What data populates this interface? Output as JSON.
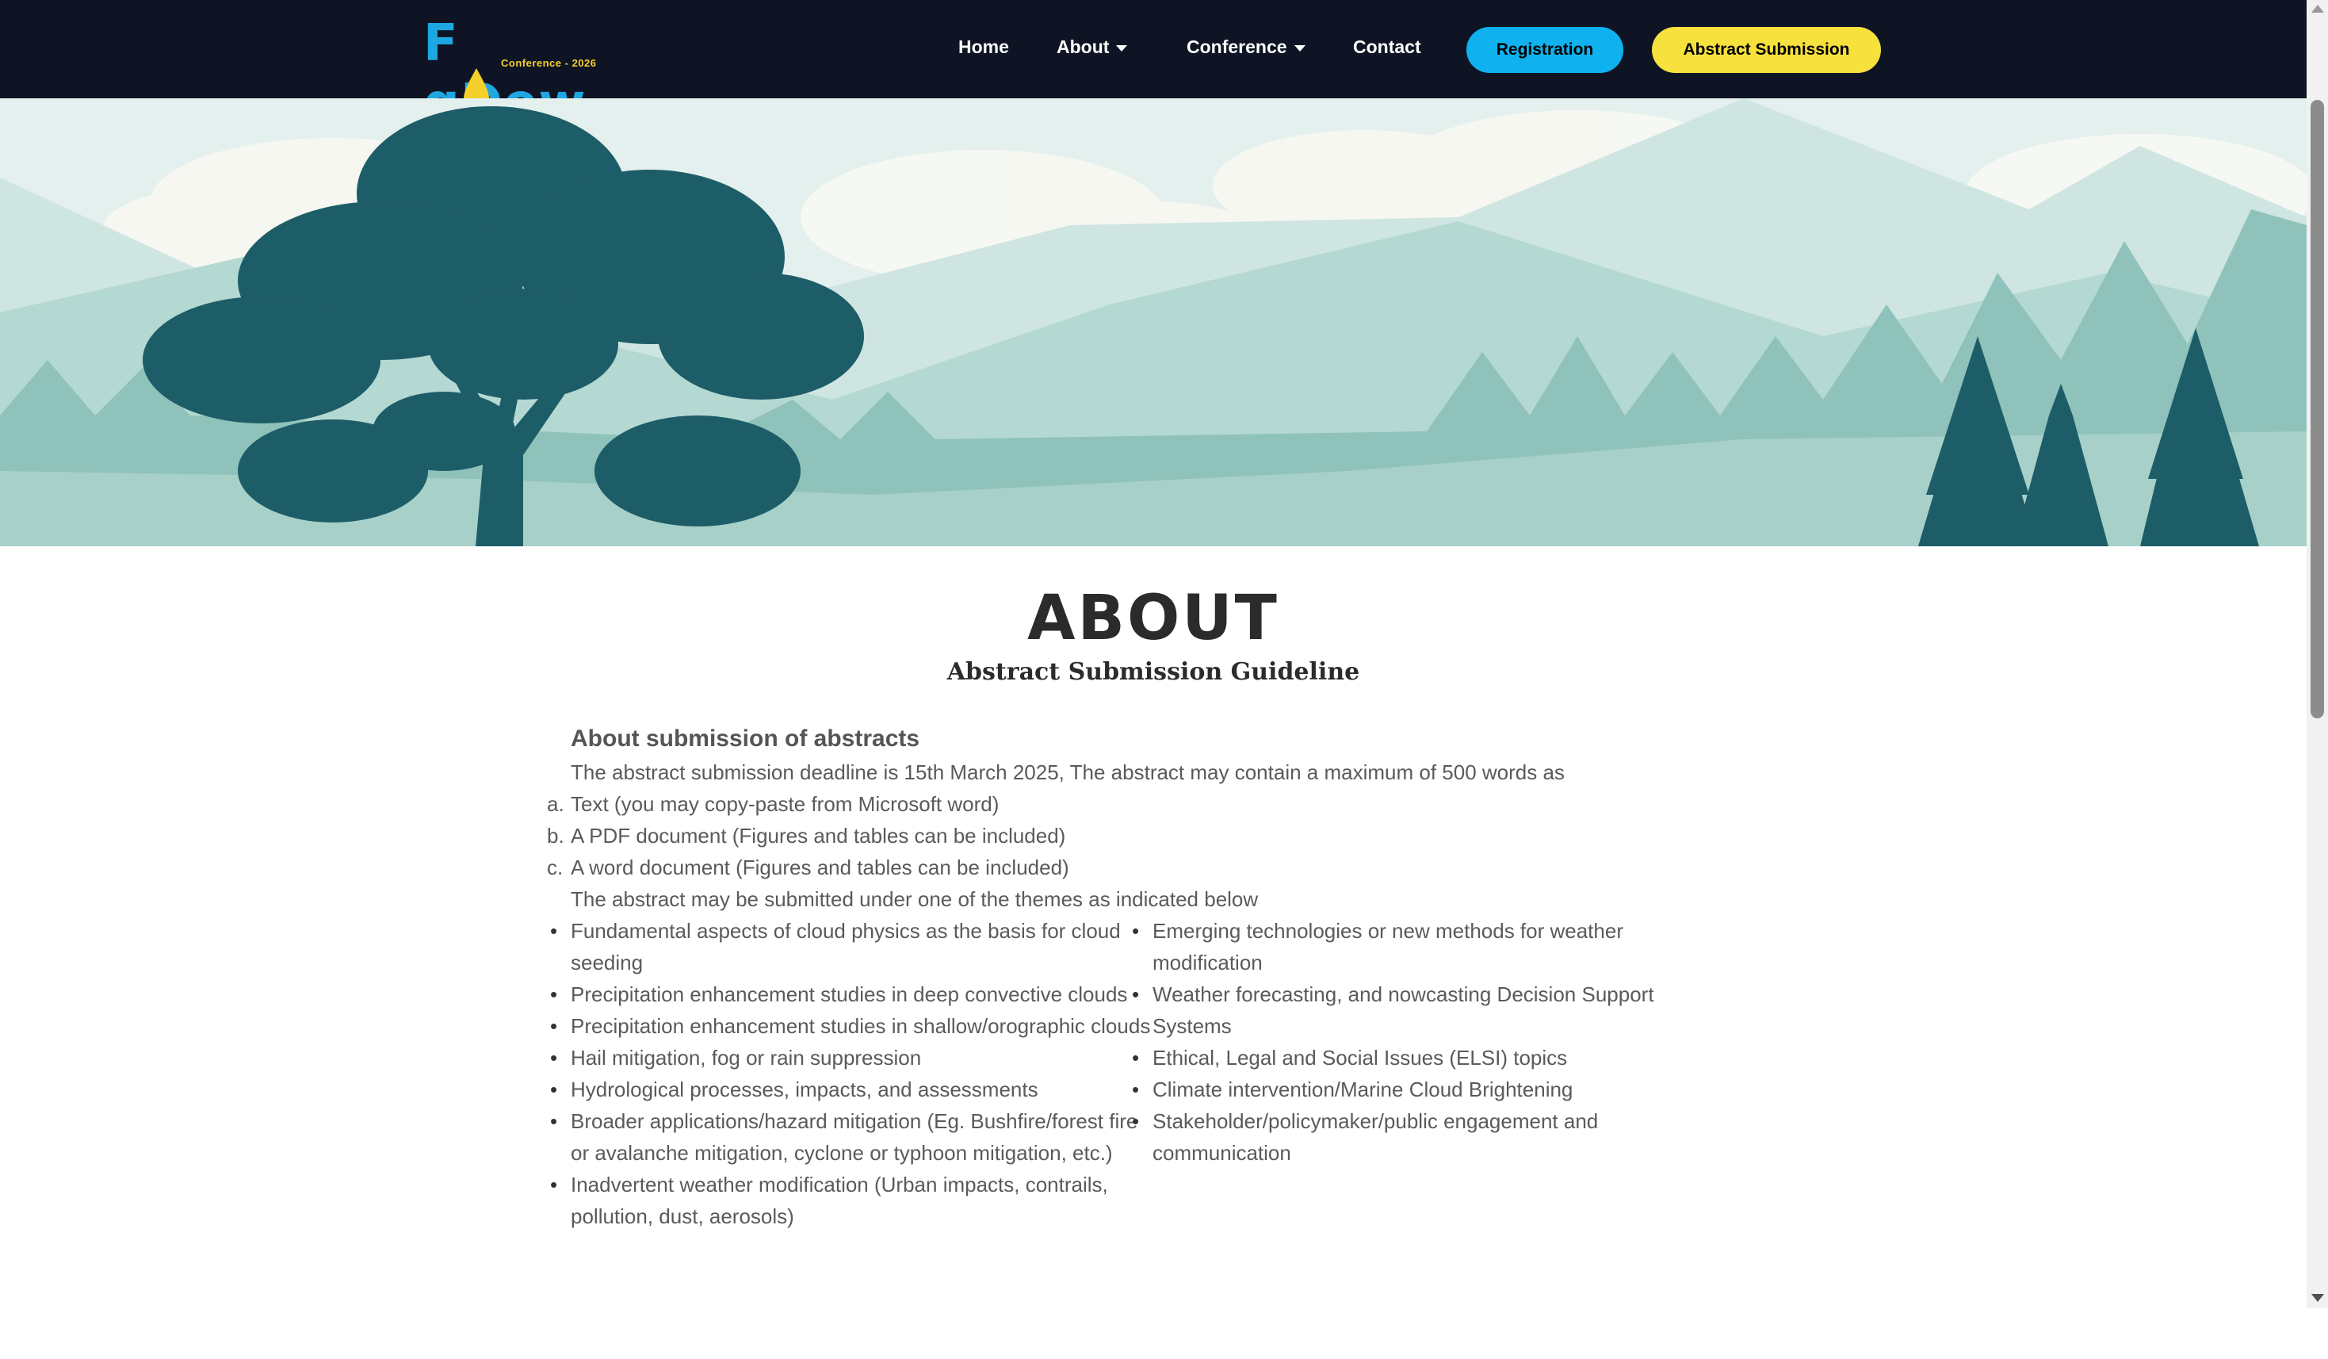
{
  "nav": {
    "logo_text_start": "F",
    "logo_text_end": "gDew",
    "logo_subtext": "Conference - 2026",
    "home": "Home",
    "about": "About",
    "conference": "Conference",
    "contact": "Contact",
    "registration": "Registration",
    "abstract_submission": "Abstract Submission"
  },
  "page": {
    "title": "ABOUT",
    "subtitle": "Abstract Submission Guideline"
  },
  "content": {
    "heading": "About submission of abstracts",
    "intro": "The abstract submission deadline is 15th March 2025, The abstract may contain a maximum of 500 words as",
    "formats": [
      {
        "marker": "a.",
        "text": "Text (you may copy-paste from Microsoft word)"
      },
      {
        "marker": "b.",
        "text": "A PDF document (Figures and tables can be included)"
      },
      {
        "marker": "c.",
        "text": "A word document (Figures and tables can be included)"
      }
    ],
    "themes_intro": "The abstract may be submitted under one of the themes as indicated below",
    "themes_left": [
      "Fundamental aspects of cloud physics as the basis for cloud seeding",
      "Precipitation enhancement studies in deep convective clouds",
      "Precipitation enhancement studies in shallow/orographic clouds",
      "Hail mitigation, fog or rain suppression",
      "Hydrological processes, impacts, and assessments",
      "Broader applications/hazard mitigation (Eg. Bushfire/forest fire or avalanche mitigation, cyclone or typhoon mitigation, etc.)",
      "Inadvertent weather modification (Urban impacts, contrails, pollution, dust, aerosols)"
    ],
    "themes_right": [
      "Emerging technologies or new methods for weather modification",
      "Weather forecasting, and nowcasting Decision Support Systems",
      "Ethical, Legal and Social Issues (ELSI) topics",
      "Climate intervention/Marine Cloud Brightening",
      "Stakeholder/policymaker/public engagement and communication"
    ]
  },
  "colors": {
    "navbar_bg": "#0e1424",
    "registration_btn": "#0fb2ef",
    "abstract_btn": "#f7e13d",
    "logo_blue": "#1ea7e1",
    "tree_teal": "#1d5d68"
  }
}
